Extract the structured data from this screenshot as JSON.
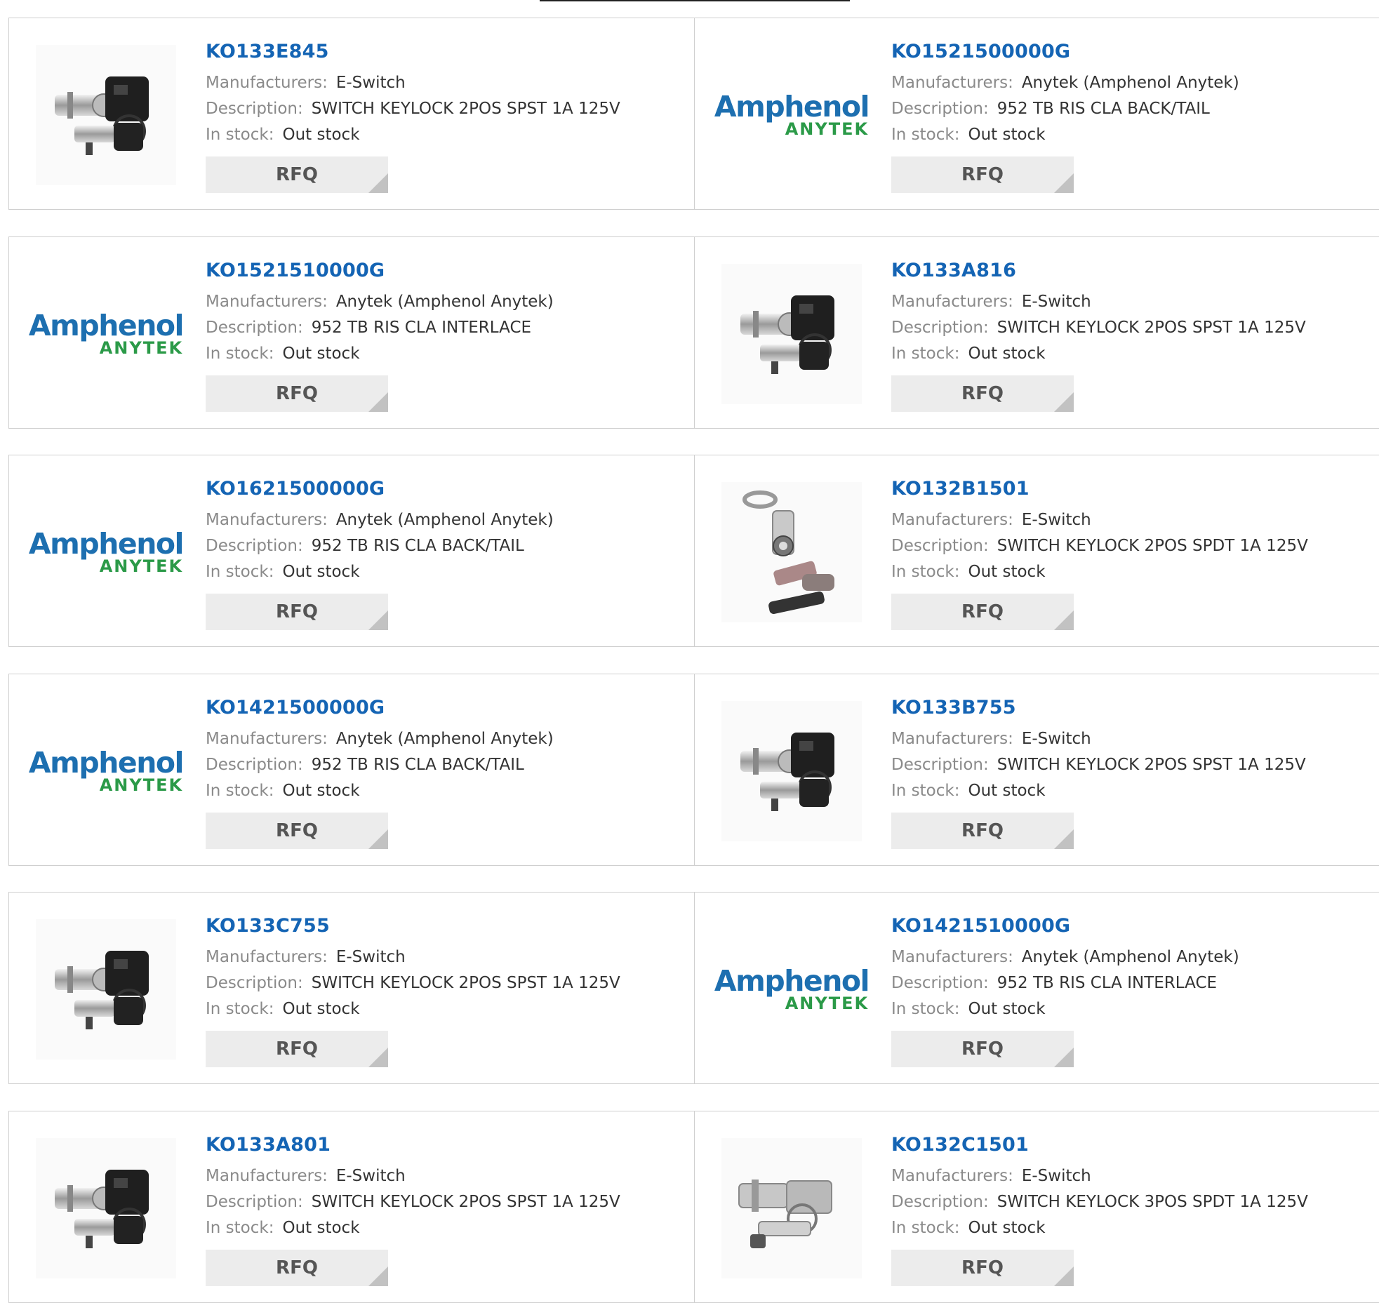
{
  "labels": {
    "manufacturer": "Manufacturers:",
    "description": "Description:",
    "stock": "In stock:",
    "rfq": "RFQ"
  },
  "logo": {
    "word": "Amphenol",
    "sub": "ANYTEK"
  },
  "products": [
    {
      "part": "KO133E845",
      "manufacturer": "E-Switch",
      "description": "SWITCH KEYLOCK 2POS SPST 1A 125V",
      "stock": "Out stock",
      "image": "keylock-switch-icon"
    },
    {
      "part": "KO1521500000G",
      "manufacturer": "Anytek (Amphenol Anytek)",
      "description": "952 TB RIS CLA BACK/TAIL",
      "stock": "Out stock",
      "image": "amphenol-logo"
    },
    {
      "part": "KO1521510000G",
      "manufacturer": "Anytek (Amphenol Anytek)",
      "description": "952 TB RIS CLA INTERLACE",
      "stock": "Out stock",
      "image": "amphenol-logo"
    },
    {
      "part": "KO133A816",
      "manufacturer": "E-Switch",
      "description": "SWITCH KEYLOCK 2POS SPST 1A 125V",
      "stock": "Out stock",
      "image": "keylock-switch-icon"
    },
    {
      "part": "KO1621500000G",
      "manufacturer": "Anytek (Amphenol Anytek)",
      "description": "952 TB RIS CLA BACK/TAIL",
      "stock": "Out stock",
      "image": "amphenol-logo"
    },
    {
      "part": "KO132B1501",
      "manufacturer": "E-Switch",
      "description": "SWITCH KEYLOCK 2POS SPDT 1A 125V",
      "stock": "Out stock",
      "image": "tubular-lock-icon"
    },
    {
      "part": "KO1421500000G",
      "manufacturer": "Anytek (Amphenol Anytek)",
      "description": "952 TB RIS CLA BACK/TAIL",
      "stock": "Out stock",
      "image": "amphenol-logo"
    },
    {
      "part": "KO133B755",
      "manufacturer": "E-Switch",
      "description": "SWITCH KEYLOCK 2POS SPST 1A 125V",
      "stock": "Out stock",
      "image": "keylock-switch-icon"
    },
    {
      "part": "KO133C755",
      "manufacturer": "E-Switch",
      "description": "SWITCH KEYLOCK 2POS SPST 1A 125V",
      "stock": "Out stock",
      "image": "keylock-switch-icon"
    },
    {
      "part": "KO1421510000G",
      "manufacturer": "Anytek (Amphenol Anytek)",
      "description": "952 TB RIS CLA INTERLACE",
      "stock": "Out stock",
      "image": "amphenol-logo"
    },
    {
      "part": "KO133A801",
      "manufacturer": "E-Switch",
      "description": "SWITCH KEYLOCK 2POS SPST 1A 125V",
      "stock": "Out stock",
      "image": "keylock-switch-icon"
    },
    {
      "part": "KO132C1501",
      "manufacturer": "E-Switch",
      "description": "SWITCH KEYLOCK 3POS SPDT 1A 125V",
      "stock": "Out stock",
      "image": "keylock-silver-icon"
    }
  ]
}
